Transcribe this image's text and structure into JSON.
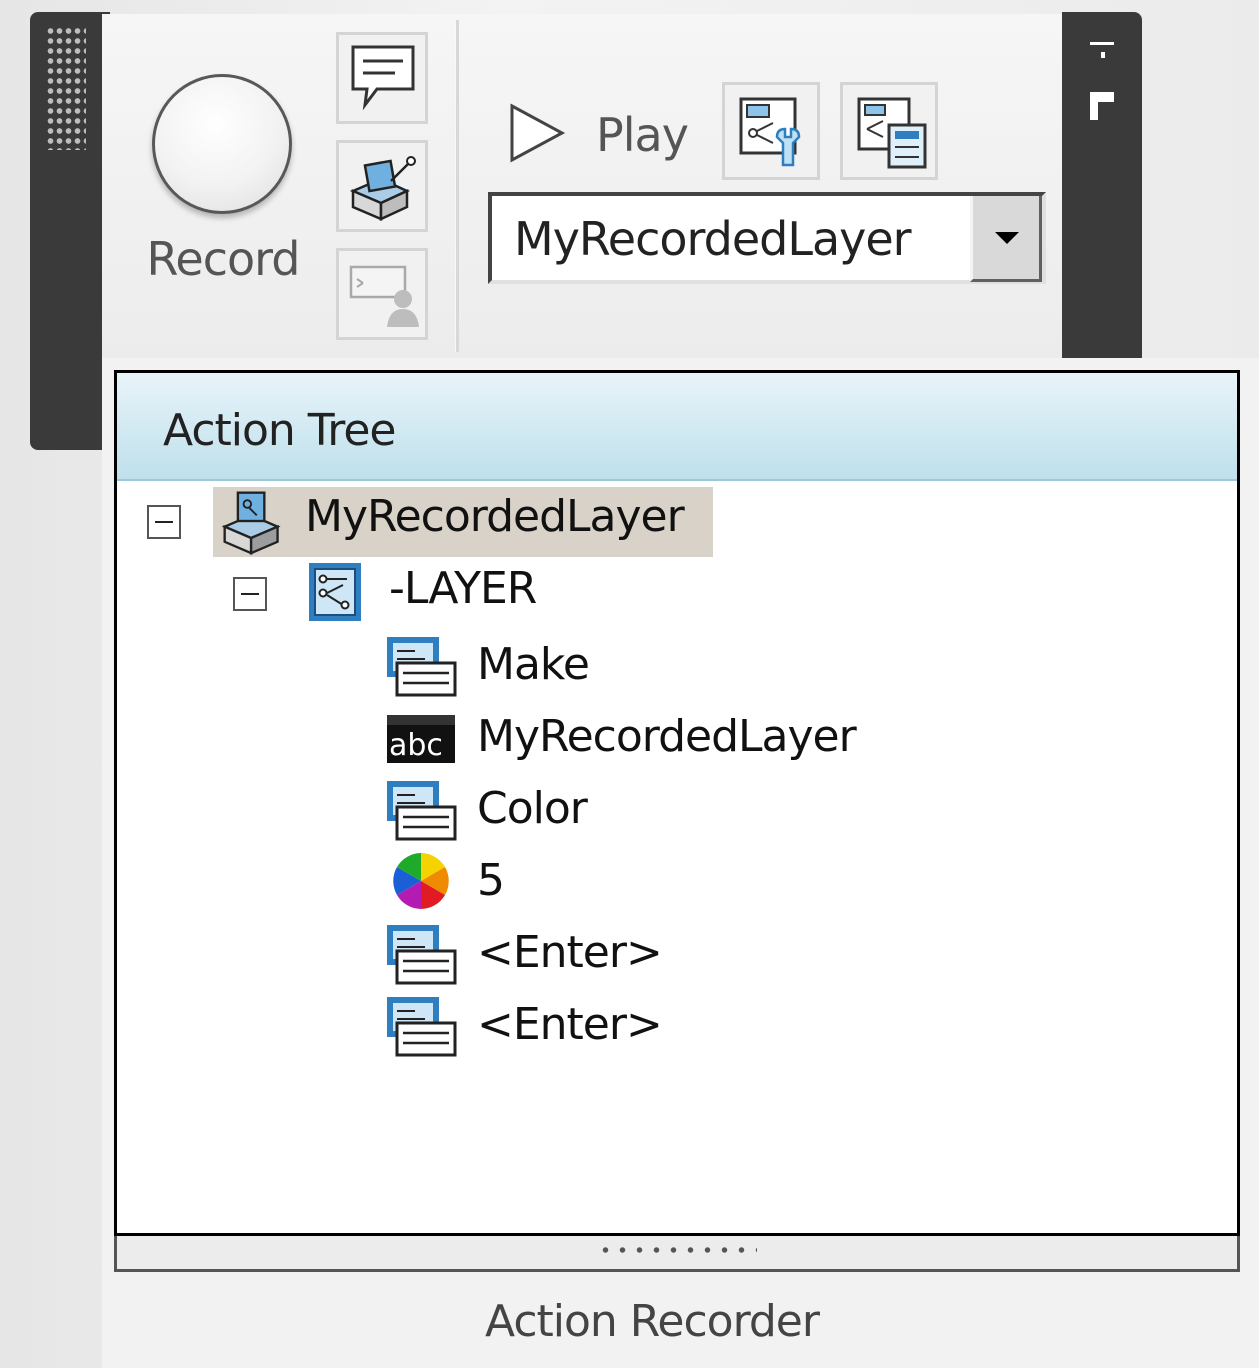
{
  "ribbon": {
    "record_label": "Record",
    "play_label": "Play",
    "macro_selector_value": "MyRecordedLayer"
  },
  "panel": {
    "tree_header": "Action Tree",
    "footer_title": "Action Recorder"
  },
  "tree": {
    "root": "MyRecordedLayer",
    "command": "-LAYER",
    "items": [
      {
        "icon": "input-request-icon",
        "label": "Make"
      },
      {
        "icon": "text-value-icon",
        "label": "MyRecordedLayer"
      },
      {
        "icon": "input-request-icon",
        "label": "Color"
      },
      {
        "icon": "color-wheel-icon",
        "label": "5"
      },
      {
        "icon": "input-request-icon",
        "label": "<Enter>"
      },
      {
        "icon": "input-request-icon",
        "label": "<Enter>"
      }
    ]
  },
  "colors": {
    "header_gradient_top": "#e8f4f9",
    "header_gradient_bottom": "#bfe0ec",
    "icon_blue": "#2f7fc0",
    "selection": "#d8d2c8"
  }
}
